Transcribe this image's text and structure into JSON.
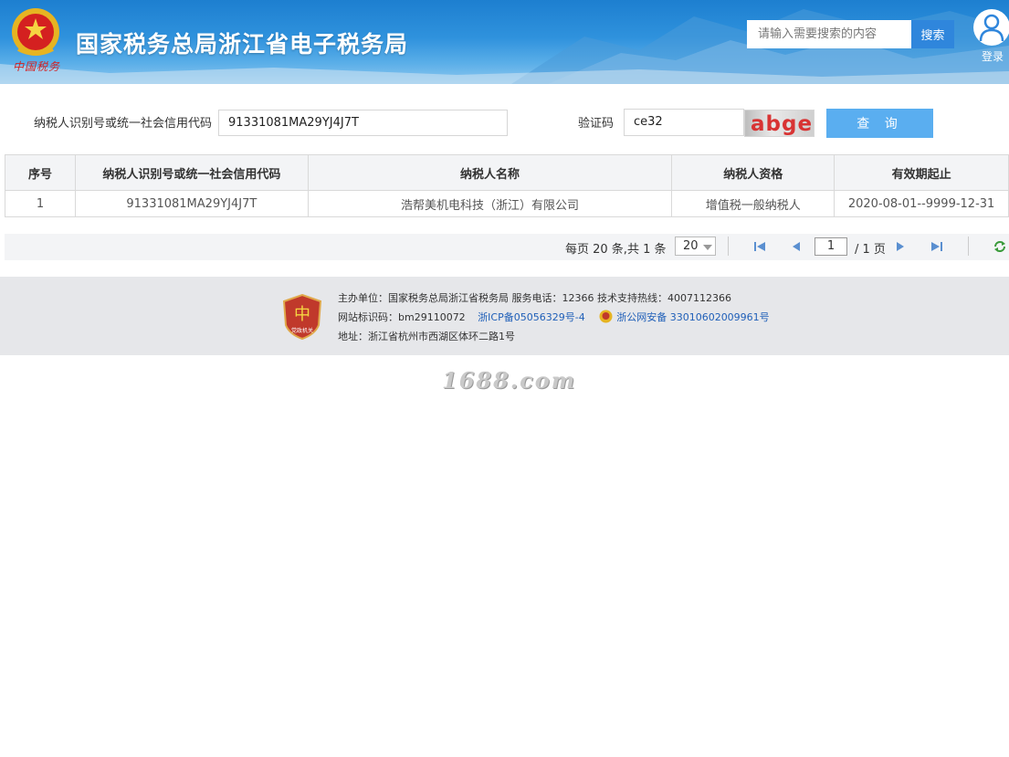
{
  "header": {
    "emblem_caption": "中国税务",
    "site_title": "国家税务总局浙江省电子税务局",
    "search_placeholder": "请输入需要搜索的内容",
    "search_button": "搜索",
    "login_label": "登录"
  },
  "query": {
    "taxpayer_id_label": "纳税人识别号或统一社会信用代码",
    "taxpayer_id_value": "91331081MA29YJ4J7T",
    "captcha_label": "验证码",
    "captcha_value": "ce32",
    "captcha_image_text": "abge",
    "query_button": "查 询"
  },
  "table": {
    "headers": [
      "序号",
      "纳税人识别号或统一社会信用代码",
      "纳税人名称",
      "纳税人资格",
      "有效期起止"
    ],
    "rows": [
      [
        "1",
        "91331081MA29YJ4J7T",
        "浩帮美机电科技（浙江）有限公司",
        "增值税一般纳税人",
        "2020-08-01--9999-12-31"
      ]
    ]
  },
  "pagination": {
    "info": "每页 20 条,共 1 条",
    "page_size": "20",
    "current_page": "1",
    "total_pages": "/ 1 页"
  },
  "footer": {
    "line1": "主办单位：国家税务总局浙江省税务局     服务电话：12366     技术支持热线：4007112366",
    "site_code": "网站标识码：bm29110072",
    "icp": "浙ICP备05056329号-4",
    "police": "浙公网安备 33010602009961号",
    "address": "地址：浙江省杭州市西湖区体环二路1号",
    "badge_caption": "党政机关"
  },
  "watermark": "1688.com",
  "colors": {
    "header_blue": "#2f92dd",
    "search_button": "#2f86dc",
    "query_button": "#5aaef0",
    "link_blue": "#1f5fb8",
    "captcha_text": "#d83333"
  }
}
